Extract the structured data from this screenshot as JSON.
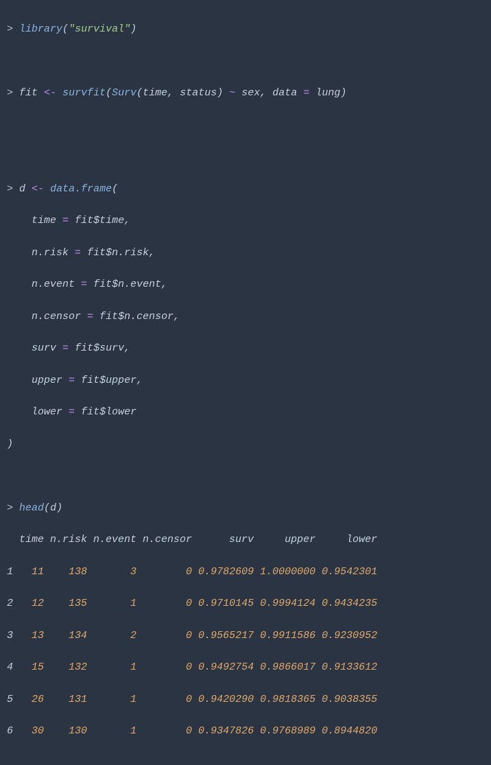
{
  "prompt": ">",
  "library_fn": "library",
  "library_arg": "\"survival\"",
  "fit_var": "fit",
  "assign_op": "<-",
  "survfit_fn": "survfit",
  "surv_fn": "Surv",
  "surv_arg1": "time",
  "surv_arg2": "status",
  "tilde_op": "~",
  "sex": "sex",
  "data_kw": "data",
  "eq_op": "=",
  "lung": "lung",
  "d_var": "d",
  "dataframe_fn": "data.frame",
  "fields": {
    "time": {
      "name": "time",
      "rhs": "fit$time"
    },
    "n_risk": {
      "name": "n.risk",
      "rhs": "fit$n.risk"
    },
    "n_event": {
      "name": "n.event",
      "rhs": "fit$n.event"
    },
    "n_censor": {
      "name": "n.censor",
      "rhs": "fit$n.censor"
    },
    "surv": {
      "name": "surv",
      "rhs": "fit$surv"
    },
    "upper": {
      "name": "upper",
      "rhs": "fit$upper"
    },
    "lower": {
      "name": "lower",
      "rhs": "fit$lower"
    }
  },
  "head_fn": "head",
  "head_arg": "d",
  "table": {
    "header": "  time n.risk n.event n.censor      surv     upper     lower",
    "rows": [
      {
        "idx": "1",
        "body": "   11    138       3        0 0.9782609 1.0000000 0.9542301"
      },
      {
        "idx": "2",
        "body": "   12    135       1        0 0.9710145 0.9994124 0.9434235"
      },
      {
        "idx": "3",
        "body": "   13    134       2        0 0.9565217 0.9911586 0.9230952"
      },
      {
        "idx": "4",
        "body": "   15    132       1        0 0.9492754 0.9866017 0.9133612"
      },
      {
        "idx": "5",
        "body": "   26    131       1        0 0.9420290 0.9818365 0.9038355"
      },
      {
        "idx": "6",
        "body": "   30    130       1        0 0.9347826 0.9768989 0.8944820"
      }
    ]
  }
}
